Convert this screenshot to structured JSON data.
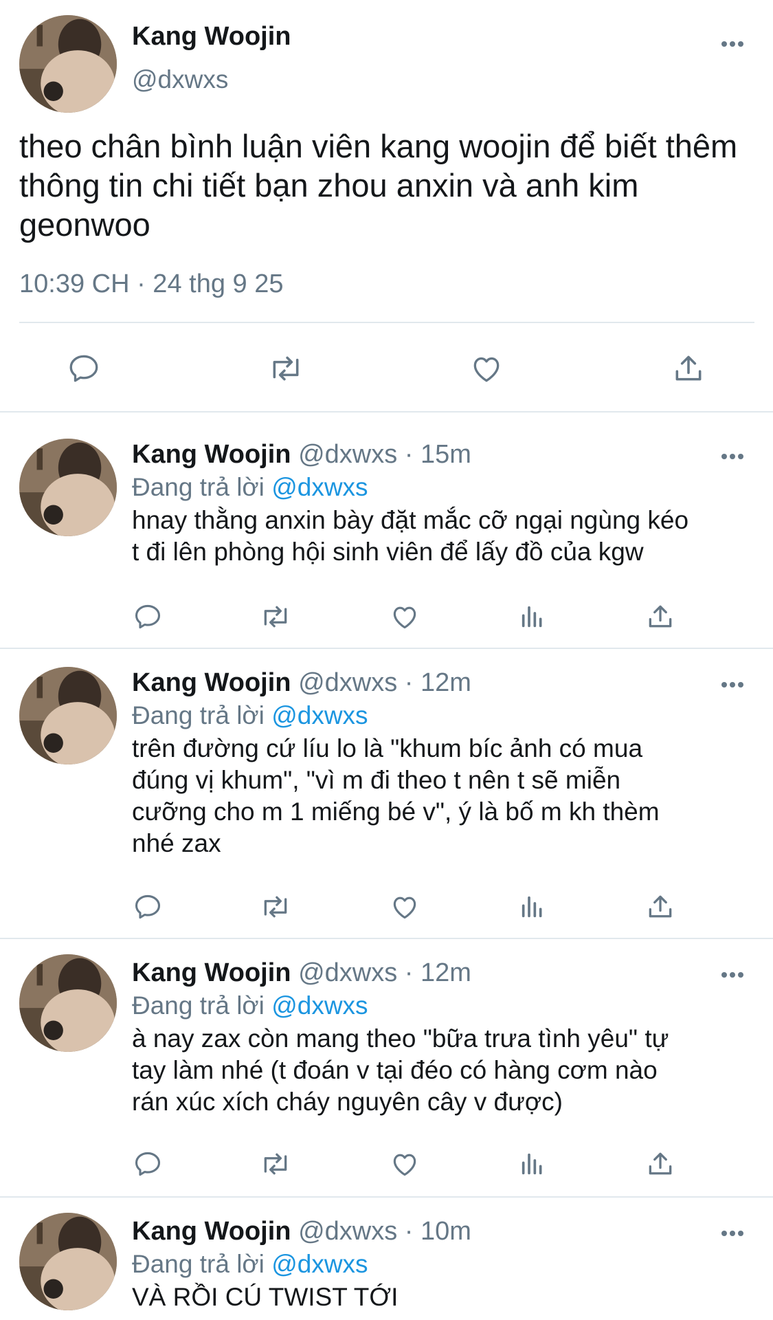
{
  "main_tweet": {
    "name": "Kang Woojin",
    "handle": "@dxwxs",
    "text": "theo chân bình luận viên kang woojin để biết thêm thông tin chi tiết bạn zhou anxin và anh kim geonwoo",
    "timestamp": "10:39 CH · 24 thg 9 25",
    "actions": [
      "reply-icon",
      "retweet-icon",
      "like-icon",
      "share-icon"
    ]
  },
  "replies": [
    {
      "name": "Kang Woojin",
      "handle": "@dxwxs",
      "time": "· 15m",
      "replying_prefix": "Đang trả lời",
      "replying_to": "@dxwxs",
      "text": "hnay thằng anxin bày đặt mắc cỡ ngại ngùng kéo\nt đi lên phòng hội sinh viên để lấy đồ của kgw"
    },
    {
      "name": "Kang Woojin",
      "handle": "@dxwxs",
      "time": "· 12m",
      "replying_prefix": "Đang trả lời",
      "replying_to": "@dxwxs",
      "text": "trên đường cứ líu lo là \"khum bíc ảnh có mua\nđúng vị khum\", \"vì m đi theo t nên t sẽ miễn\ncưỡng cho m 1 miếng bé v\", ý là bố m kh thèm\nnhé zax"
    },
    {
      "name": "Kang Woojin",
      "handle": "@dxwxs",
      "time": "· 12m",
      "replying_prefix": "Đang trả lời",
      "replying_to": "@dxwxs",
      "text": "à nay zax còn mang theo \"bữa trưa tình yêu\" tự\ntay làm nhé (t đoán v tại đéo có hàng cơm nào\nrán xúc xích cháy nguyên cây v được)"
    },
    {
      "name": "Kang Woojin",
      "handle": "@dxwxs",
      "time": "· 10m",
      "replying_prefix": "Đang trả lời",
      "replying_to": "@dxwxs",
      "text": "VÀ RỒI CÚ TWIST TỚI"
    }
  ],
  "colors": {
    "text": "#14171a",
    "secondary": "#657786",
    "link": "#1b95e0",
    "divider": "#e1e8ed"
  }
}
